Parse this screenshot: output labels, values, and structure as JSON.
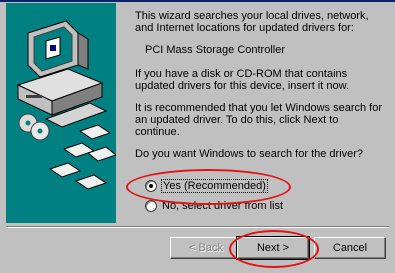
{
  "wizard": {
    "intro": "This wizard searches your local drives, network, and Internet locations for updated drivers for:",
    "device_name": "PCI Mass Storage Controller",
    "disk_text": "If you have a disk or CD-ROM that contains updated drivers for this device, insert it now.",
    "recommend_text": "It is recommended that you let Windows search for an updated driver. To do this, click Next to continue.",
    "question": "Do you want Windows to search for the driver?",
    "options": [
      {
        "label": "Yes (Recommended)",
        "selected": true
      },
      {
        "label": "No, select driver from list",
        "selected": false
      }
    ]
  },
  "buttons": {
    "back": "< Back",
    "next": "Next >",
    "cancel": "Cancel"
  },
  "colors": {
    "side_panel": "#008080",
    "annotation": "#e21414"
  }
}
